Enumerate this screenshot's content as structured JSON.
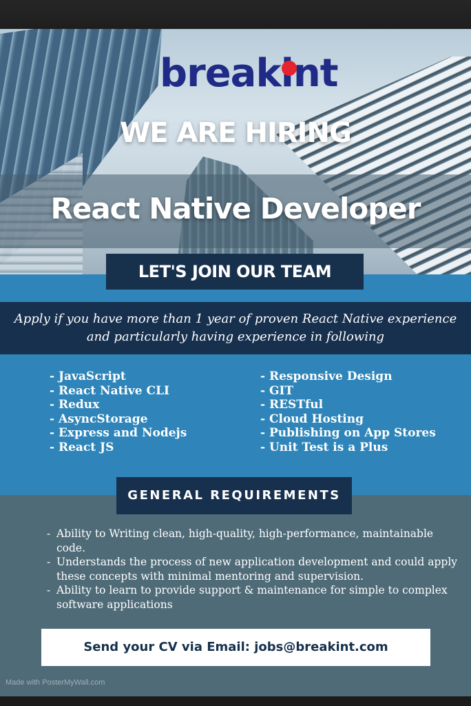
{
  "brand": {
    "name": "breakint",
    "accent_color": "#e5252b",
    "text_color": "#1f2b86"
  },
  "headline": "WE ARE HIRING",
  "role": "React Native Developer",
  "cta": "LET'S JOIN OUR TEAM",
  "intro": {
    "line1": "Apply if you have more than 1 year of proven React Native experience",
    "line2": "and particularly having experience in following"
  },
  "skills": {
    "left": [
      "- JavaScript",
      "- React Native CLI",
      "- Redux",
      "- AsyncStorage",
      "- Express and Nodejs",
      "- React JS"
    ],
    "right": [
      "- Responsive Design",
      "- GIT",
      "- RESTful",
      "- Cloud Hosting",
      "- Publishing on App Stores",
      "- Unit Test is a Plus"
    ]
  },
  "requirements": {
    "title": "GENERAL REQUIREMENTS",
    "items": [
      "Ability to Writing clean, high-quality, high-performance, maintainable code.",
      "Understands the process of new application development and could apply these concepts with minimal mentoring and supervision.",
      "Ability to learn to provide support & maintenance for simple to complex software applications"
    ]
  },
  "contact": "Send your CV via Email: jobs@breakint.com",
  "watermark": "Made with PosterMyWall.com"
}
